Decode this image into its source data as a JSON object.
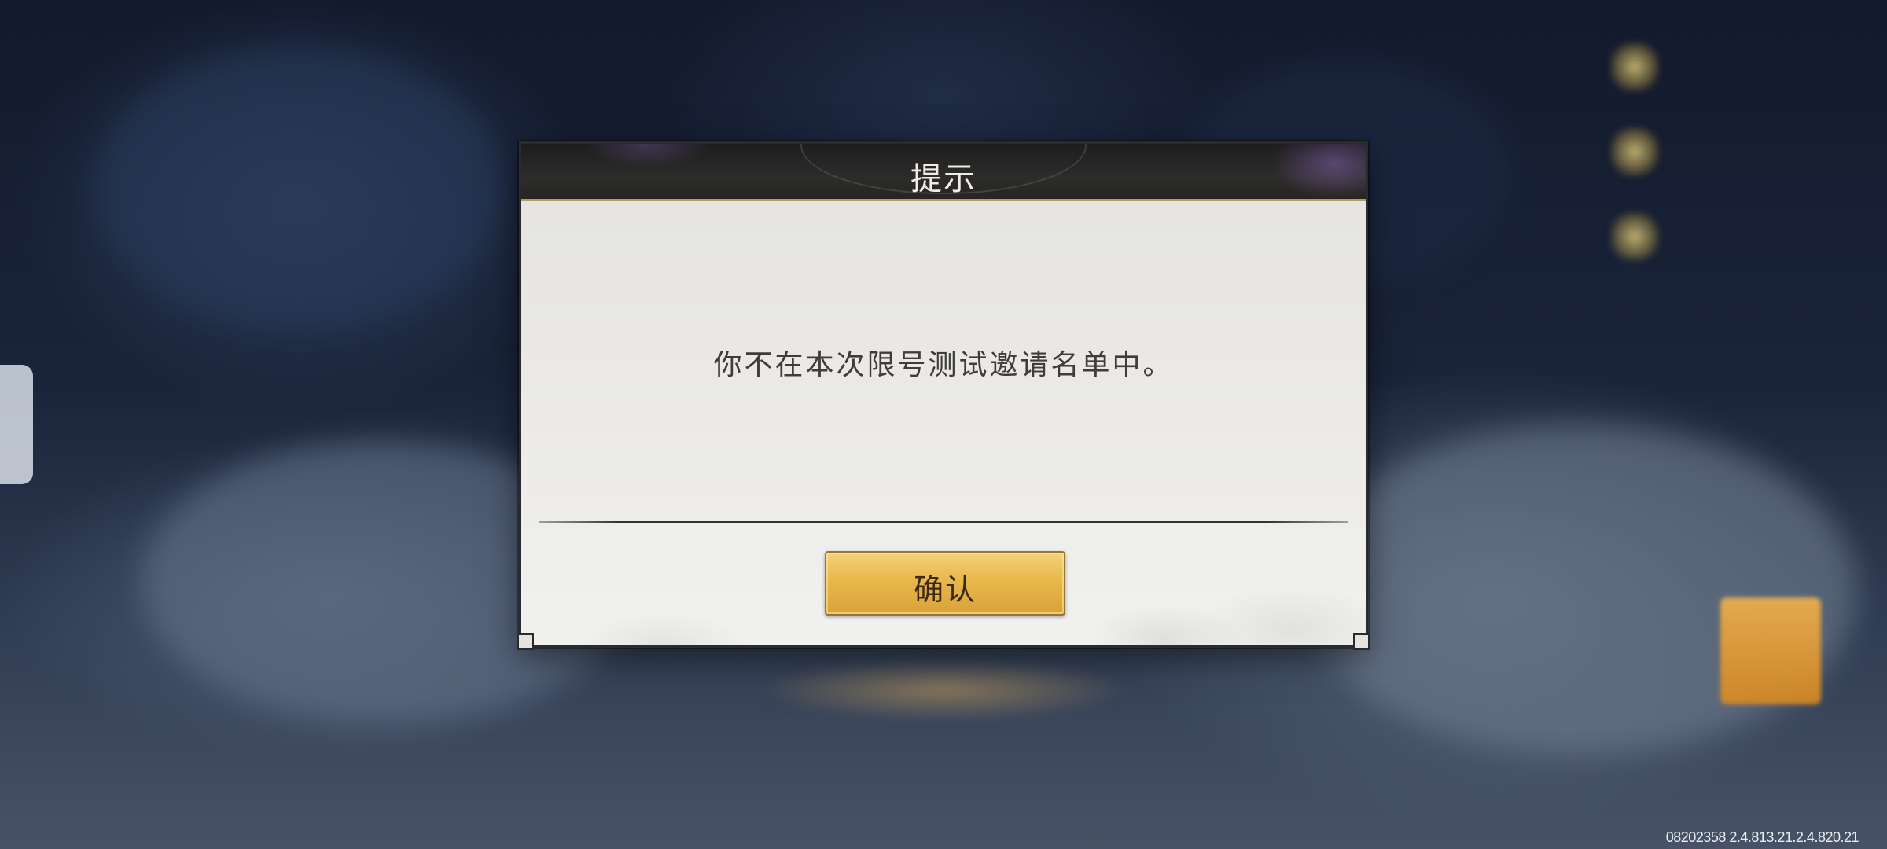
{
  "dialog": {
    "title": "提示",
    "message": "你不在本次限号测试邀请名单中。",
    "confirm_label": "确认"
  },
  "footer": {
    "version_text": "08202358 2.4.813.21.2.4.820.21"
  },
  "colors": {
    "dialog_body": "#ecebe8",
    "dialog_header": "#262524",
    "header_accent": "#b89a62",
    "button_gold": "#e8b84b",
    "button_text": "#3b2a15",
    "message_text": "#3e3d3b"
  },
  "icons": {
    "side_icons": [
      "menu-icon",
      "menu-icon",
      "menu-icon"
    ],
    "orange_button": "gift-icon"
  }
}
